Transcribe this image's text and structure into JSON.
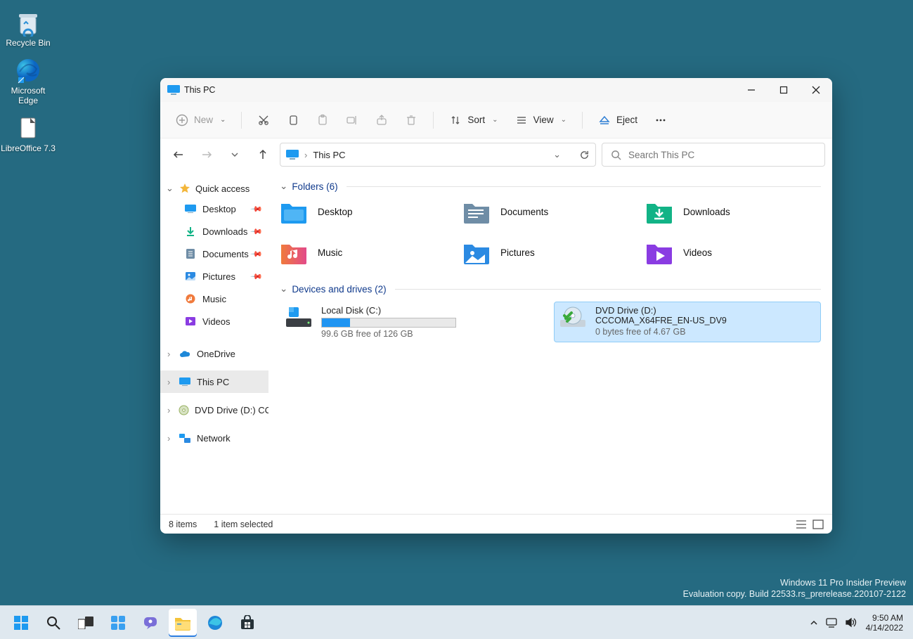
{
  "desktop": {
    "icons": [
      {
        "label": "Recycle Bin"
      },
      {
        "label": "Microsoft Edge"
      },
      {
        "label": "LibreOffice 7.3"
      }
    ]
  },
  "watermark": {
    "line1": "Windows 11 Pro Insider Preview",
    "line2": "Evaluation copy. Build 22533.rs_prerelease.220107-2122"
  },
  "window": {
    "title": "This PC",
    "toolbar": {
      "new": "New",
      "sort": "Sort",
      "view": "View",
      "eject": "Eject"
    },
    "address": {
      "location": "This PC"
    },
    "search": {
      "placeholder": "Search This PC"
    },
    "sidebar": {
      "quick_access": "Quick access",
      "quick_items": [
        {
          "label": "Desktop"
        },
        {
          "label": "Downloads"
        },
        {
          "label": "Documents"
        },
        {
          "label": "Pictures"
        },
        {
          "label": "Music"
        },
        {
          "label": "Videos"
        }
      ],
      "onedrive": "OneDrive",
      "this_pc": "This PC",
      "dvd": "DVD Drive (D:) CCCO",
      "network": "Network"
    },
    "sections": {
      "folders_label": "Folders (6)",
      "drives_label": "Devices and drives (2)"
    },
    "folders": [
      {
        "label": "Desktop",
        "color": "#1e9af0"
      },
      {
        "label": "Documents",
        "color": "#6f8da6"
      },
      {
        "label": "Downloads",
        "color": "#12b386"
      },
      {
        "label": "Music",
        "color": "#f07a3c"
      },
      {
        "label": "Pictures",
        "color": "#2b8ae2"
      },
      {
        "label": "Videos",
        "color": "#8a3ce2"
      }
    ],
    "drives": {
      "c": {
        "name": "Local Disk (C:)",
        "free_text": "99.6 GB free of 126 GB",
        "used_pct": 21
      },
      "d": {
        "name": "DVD Drive (D:)",
        "volume": "CCCOMA_X64FRE_EN-US_DV9",
        "free_text": "0 bytes free of 4.67 GB"
      }
    },
    "status": {
      "items": "8 items",
      "selected": "1 item selected"
    }
  },
  "taskbar": {
    "time": "9:50 AM",
    "date": "4/14/2022"
  }
}
